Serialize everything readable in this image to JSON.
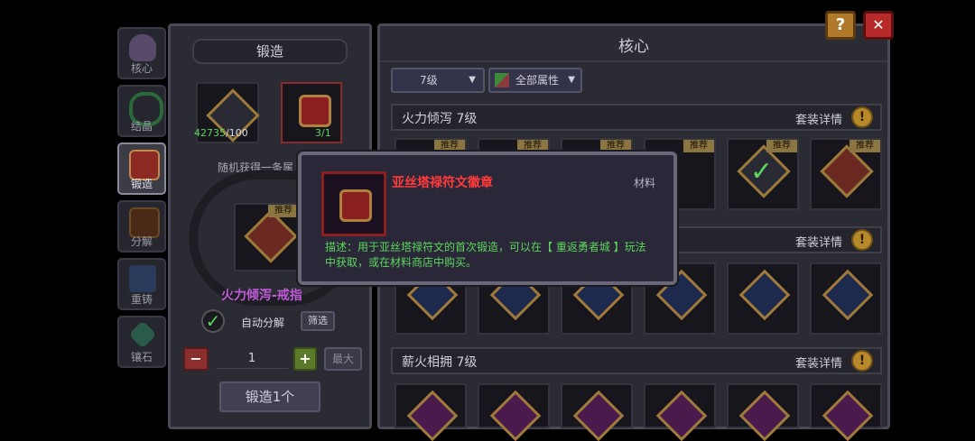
{
  "sidebar": {
    "items": [
      {
        "label": "核心",
        "icon": "flask-icon"
      },
      {
        "label": "结晶",
        "icon": "crystal-ring-icon"
      },
      {
        "label": "锻造",
        "icon": "forge-chest-icon"
      },
      {
        "label": "分解",
        "icon": "decompose-icon"
      },
      {
        "label": "重铸",
        "icon": "recast-icon"
      },
      {
        "label": "镶石",
        "icon": "gem-inlay-icon"
      }
    ]
  },
  "forge": {
    "title": "锻造",
    "material1_count": "42735",
    "material1_need": "/100",
    "material2_count": "3/1",
    "random_text": "随机获得一条属",
    "result_name": "火力倾泻-戒指",
    "result_tag": "推荐",
    "auto_decompose": "自动分解",
    "filter": "筛选",
    "quantity": "1",
    "minus": "−",
    "plus": "+",
    "max": "最大",
    "forge_button": "锻造1个"
  },
  "core": {
    "title": "核心",
    "level_select": "7级",
    "attr_select": "全部属性",
    "set_detail": "套装详情",
    "sets": [
      {
        "name": "火力倾泻 7级",
        "tags": [
          "推荐",
          "推荐",
          "推荐",
          "推荐",
          "推荐",
          "推荐"
        ]
      },
      {
        "name": "",
        "tags": []
      },
      {
        "name": "薪火相拥 7级",
        "tags": []
      }
    ]
  },
  "tooltip": {
    "item_name": "亚丝塔禄符文徽章",
    "category": "材料",
    "description": "描述：用于亚丝塔禄符文的首次锻造，可以在【 重返勇者城 】玩法中获取，或在材料商店中购买。"
  },
  "top": {
    "help": "?",
    "close": "✕"
  },
  "colors": {
    "accent_red": "#ff3b3b",
    "green_text": "#5cd65c",
    "gold": "#c9a13c",
    "purple_name": "#c05ad8"
  }
}
